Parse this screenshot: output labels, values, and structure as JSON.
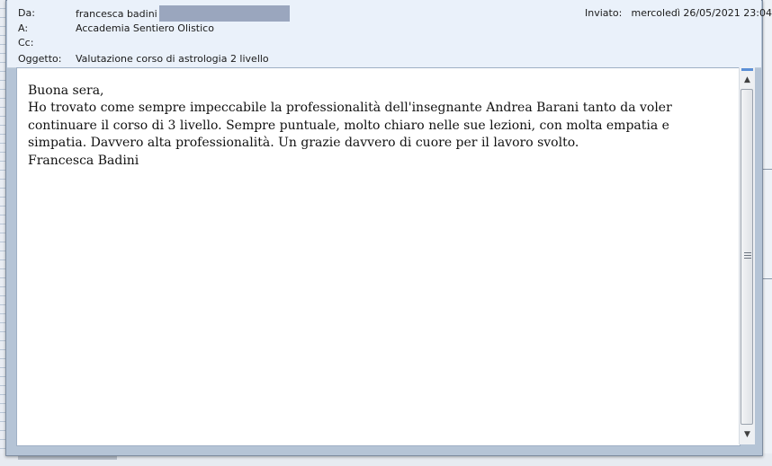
{
  "header": {
    "from_label": "Da:",
    "from_value": "francesca badini",
    "to_label": "A:",
    "to_value": "Accademia Sentiero Olistico",
    "cc_label": "Cc:",
    "cc_value": "",
    "subject_label": "Oggetto:",
    "subject_value": "Valutazione corso di astrologia 2 livello",
    "sent_label": "Inviato:",
    "sent_value": "mercoledì 26/05/2021 23:04"
  },
  "message": {
    "line1": "Buona sera,",
    "line2": "Ho trovato come sempre impeccabile la professionalità dell'insegnante Andrea Barani tanto da voler continuare il corso di 3 livello. Sempre puntuale, molto chiaro nelle sue lezioni, con molta empatia e simpatia. Davvero alta professionalità. Un grazie davvero di cuore per il lavoro svolto.",
    "line3": "Francesca Badini"
  },
  "icons": {
    "scroll_up": "scroll-up-arrow-icon",
    "scroll_down": "scroll-down-arrow-icon",
    "grip": "scroll-grip-icon"
  },
  "colors": {
    "header_bg": "#eaf1fa",
    "frame": "#b5c4d6",
    "redaction": "#9aa6be"
  }
}
